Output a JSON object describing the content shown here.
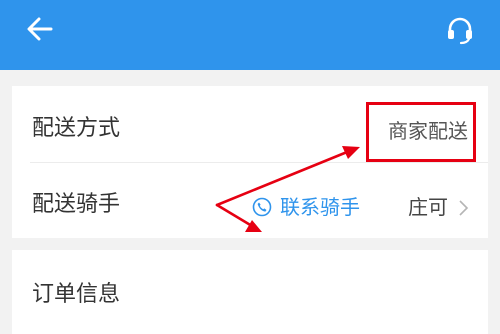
{
  "header": {
    "back_icon": "back-arrow-icon",
    "support_icon": "headset-icon",
    "color": "#2f94ec"
  },
  "delivery": {
    "method_label": "配送方式",
    "method_value": "商家配送",
    "rider_label": "配送骑手",
    "contact_rider_label": "联系骑手",
    "contact_icon": "phone-icon",
    "rider_name": "庄可",
    "chevron_icon": "chevron-right-icon"
  },
  "order": {
    "title": "订单信息"
  },
  "annotation": {
    "color": "#e60012"
  }
}
